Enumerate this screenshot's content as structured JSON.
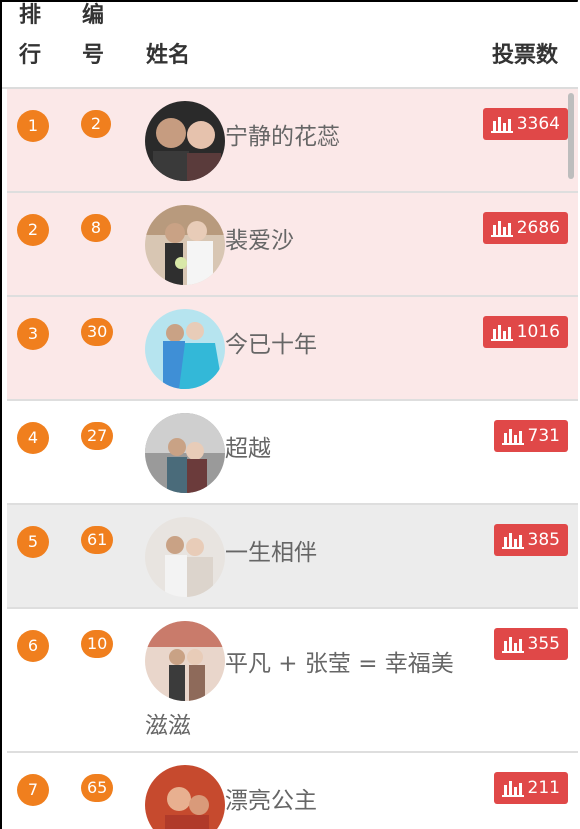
{
  "header": {
    "rank_label": "排行",
    "no_label": "编号",
    "name_label": "姓名",
    "votes_label": "投票数"
  },
  "rows": [
    {
      "rank": "1",
      "no": "2",
      "name": "宁静的花蕊",
      "votes": "3364",
      "style": "pink"
    },
    {
      "rank": "2",
      "no": "8",
      "name": "裴爱沙",
      "votes": "2686",
      "style": "pink"
    },
    {
      "rank": "3",
      "no": "30",
      "name": "今已十年",
      "votes": "1016",
      "style": "pink"
    },
    {
      "rank": "4",
      "no": "27",
      "name": "超越",
      "votes": "731",
      "style": "white"
    },
    {
      "rank": "5",
      "no": "61",
      "name": "一生相伴",
      "votes": "385",
      "style": "gray"
    },
    {
      "rank": "6",
      "no": "10",
      "name": "平凡 + 张莹 = 幸福美滋滋",
      "votes": "355",
      "style": "white"
    },
    {
      "rank": "7",
      "no": "65",
      "name": "漂亮公主",
      "votes": "211",
      "style": "white"
    }
  ],
  "icons": {
    "vote": "bar-chart-icon",
    "avatar": "avatar-photo"
  },
  "colors": {
    "badge": "#f07f1e",
    "vote": "#e04848",
    "top3_bg": "#fbe8e8"
  }
}
